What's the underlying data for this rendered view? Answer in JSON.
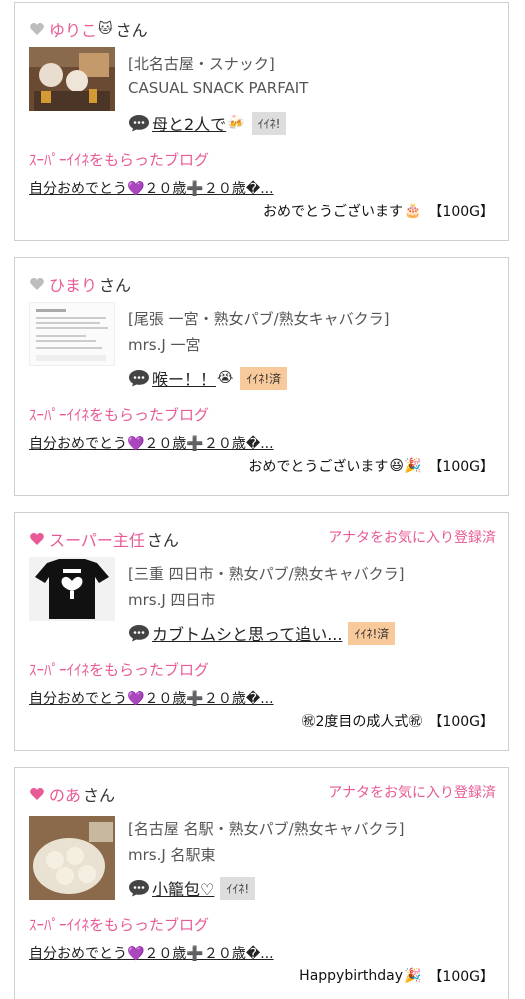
{
  "posts": [
    {
      "user": "ゆりこ",
      "user_emoji": "🐱",
      "san": "さん",
      "heart_color": "#bdbdbd",
      "favorite_label": "",
      "shop_line1": "[北名古屋・スナック]",
      "shop_line2": "CASUAL SNACK PARFAIT",
      "comment": "母と2人で",
      "comment_emoji": "🍻",
      "iine_label": "ｲｲﾈ!",
      "iine_done": false,
      "super_label": "ｽｰﾊﾟｰｲｲﾈをもらったブログ",
      "blog_title": "自分おめでとう💜２０歳➕２０歳�...",
      "message": "おめでとうございます",
      "message_emoji": "🎂",
      "points": "【100G】"
    },
    {
      "user": "ひまり",
      "user_emoji": "",
      "san": "さん",
      "heart_color": "#bdbdbd",
      "favorite_label": "",
      "shop_line1": "[尾張 一宮・熟女パブ/熟女キャバクラ]",
      "shop_line2": "mrs.J 一宮",
      "comment": "喉ー！！",
      "comment_emoji": "😭",
      "iine_label": "ｲｲﾈ!済",
      "iine_done": true,
      "super_label": "ｽｰﾊﾟｰｲｲﾈをもらったブログ",
      "blog_title": "自分おめでとう💜２０歳➕２０歳�...",
      "message": "おめでとうございます",
      "message_emoji": "😆🎉",
      "points": "【100G】"
    },
    {
      "user": "スーパー主任",
      "user_emoji": "",
      "san": "さん",
      "heart_color": "#e85a96",
      "favorite_label": "アナタをお気に入り登録済",
      "shop_line1": "[三重 四日市・熟女パブ/熟女キャバクラ]",
      "shop_line2": "mrs.J 四日市",
      "comment": "カブトムシと思って追い...",
      "comment_emoji": "",
      "iine_label": "ｲｲﾈ!済",
      "iine_done": true,
      "super_label": "ｽｰﾊﾟｰｲｲﾈをもらったブログ",
      "blog_title": "自分おめでとう💜２０歳➕２０歳�...",
      "message": "㊗2度目の成人式㊗",
      "message_emoji": "",
      "points": "【100G】"
    },
    {
      "user": "のあ",
      "user_emoji": "",
      "san": "さん",
      "heart_color": "#e85a96",
      "favorite_label": "アナタをお気に入り登録済",
      "shop_line1": "[名古屋 名駅・熟女パブ/熟女キャバクラ]",
      "shop_line2": "mrs.J 名駅東",
      "comment": "小籠包♡",
      "comment_emoji": "",
      "iine_label": "ｲｲﾈ!",
      "iine_done": false,
      "super_label": "ｽｰﾊﾟｰｲｲﾈをもらったブログ",
      "blog_title": "自分おめでとう💜２０歳➕２０歳�...",
      "message": "Happybirthday",
      "message_emoji": "🎉",
      "points": "【100G】"
    }
  ]
}
